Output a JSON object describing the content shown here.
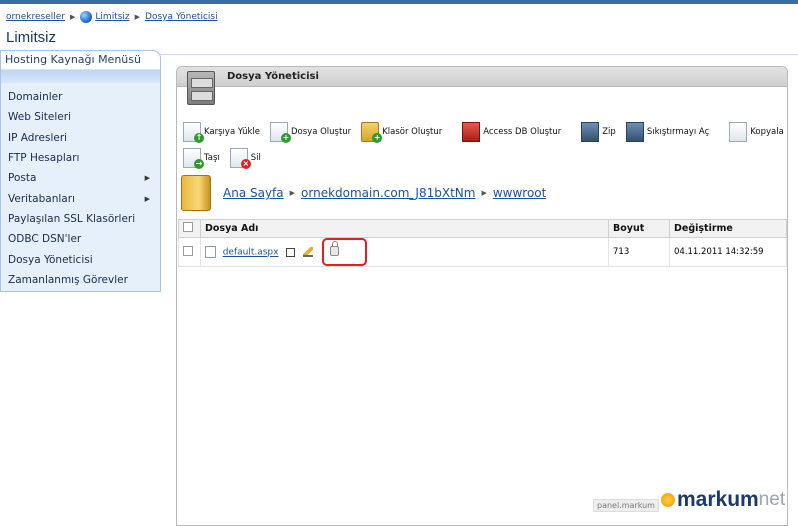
{
  "breadcrumb": {
    "items": [
      "ornekreseller",
      "Limitsiz",
      "Dosya Yöneticisi"
    ]
  },
  "page": {
    "title": "Limitsiz"
  },
  "sidebar": {
    "title": "Hosting Kaynağı Menüsü",
    "items": [
      {
        "label": "Domainler",
        "has_submenu": false
      },
      {
        "label": "Web Siteleri",
        "has_submenu": false
      },
      {
        "label": "IP Adresleri",
        "has_submenu": false
      },
      {
        "label": "FTP Hesapları",
        "has_submenu": false
      },
      {
        "label": "Posta",
        "has_submenu": true
      },
      {
        "label": "Veritabanları",
        "has_submenu": true
      },
      {
        "label": "Paylaşılan SSL Klasörleri",
        "has_submenu": false
      },
      {
        "label": "ODBC DSN'ler",
        "has_submenu": false
      },
      {
        "label": "Dosya Yöneticisi",
        "has_submenu": false
      },
      {
        "label": "Zamanlanmış Görevler",
        "has_submenu": false
      }
    ]
  },
  "panel": {
    "title": "Dosya Yöneticisi"
  },
  "toolbar": {
    "upload": "Karşıya Yükle",
    "create_file": "Dosya Oluştur",
    "create_folder": "Klasör Oluştur",
    "create_access_db": "Access DB Oluştur",
    "zip": "Zip",
    "unzip": "Sıkıştırmayı Aç",
    "copy": "Kopyala",
    "move": "Taşı",
    "delete": "Sil"
  },
  "path": {
    "home": "Ana Sayfa",
    "domain": "ornekdomain.com_J81bXtNm",
    "folder": "wwwroot"
  },
  "table": {
    "headers": {
      "name": "Dosya Adı",
      "size": "Boyut",
      "modified": "Değiştirme"
    },
    "rows": [
      {
        "name": "default.aspx",
        "size": "713",
        "modified": "04.11.2011 14:32:59"
      }
    ]
  },
  "watermark": {
    "small": "panel.markum",
    "brand_bold": "markum",
    "brand_light": "net"
  },
  "colors": {
    "accent": "#1f4fa0",
    "highlight": "#e02020",
    "sidebar_bg": "#e6f0fb"
  }
}
